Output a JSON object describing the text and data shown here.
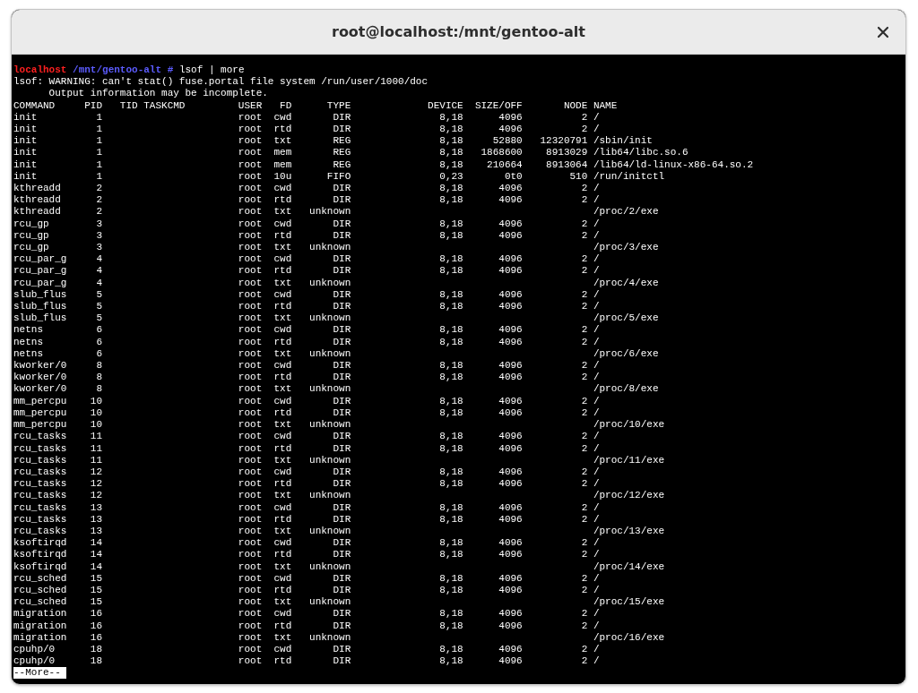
{
  "window": {
    "title": "root@localhost:/mnt/gentoo-alt"
  },
  "terminal": {
    "prompt": {
      "host": "localhost",
      "path": "/mnt/gentoo-alt",
      "symbol": "#",
      "command": "lsof | more"
    },
    "messages": [
      "lsof: WARNING: can't stat() fuse.portal file system /run/user/1000/doc",
      "      Output information may be incomplete."
    ],
    "columns": [
      "COMMAND",
      "PID",
      "TID",
      "TASKCMD",
      "USER",
      "FD",
      "TYPE",
      "DEVICE",
      "SIZE/OFF",
      "NODE",
      "NAME"
    ],
    "rows": [
      {
        "command": "init",
        "pid": "1",
        "user": "root",
        "fd": "cwd",
        "type": "DIR",
        "device": "8,18",
        "size_off": "4096",
        "node": "2",
        "name": "/"
      },
      {
        "command": "init",
        "pid": "1",
        "user": "root",
        "fd": "rtd",
        "type": "DIR",
        "device": "8,18",
        "size_off": "4096",
        "node": "2",
        "name": "/"
      },
      {
        "command": "init",
        "pid": "1",
        "user": "root",
        "fd": "txt",
        "type": "REG",
        "device": "8,18",
        "size_off": "52880",
        "node": "12320791",
        "name": "/sbin/init"
      },
      {
        "command": "init",
        "pid": "1",
        "user": "root",
        "fd": "mem",
        "type": "REG",
        "device": "8,18",
        "size_off": "1868600",
        "node": "8913029",
        "name": "/lib64/libc.so.6"
      },
      {
        "command": "init",
        "pid": "1",
        "user": "root",
        "fd": "mem",
        "type": "REG",
        "device": "8,18",
        "size_off": "210664",
        "node": "8913064",
        "name": "/lib64/ld-linux-x86-64.so.2"
      },
      {
        "command": "init",
        "pid": "1",
        "user": "root",
        "fd": "10u",
        "type": "FIFO",
        "device": "0,23",
        "size_off": "0t0",
        "node": "510",
        "name": "/run/initctl"
      },
      {
        "command": "kthreadd",
        "pid": "2",
        "user": "root",
        "fd": "cwd",
        "type": "DIR",
        "device": "8,18",
        "size_off": "4096",
        "node": "2",
        "name": "/"
      },
      {
        "command": "kthreadd",
        "pid": "2",
        "user": "root",
        "fd": "rtd",
        "type": "DIR",
        "device": "8,18",
        "size_off": "4096",
        "node": "2",
        "name": "/"
      },
      {
        "command": "kthreadd",
        "pid": "2",
        "user": "root",
        "fd": "txt",
        "type": "unknown",
        "name": "/proc/2/exe"
      },
      {
        "command": "rcu_gp",
        "pid": "3",
        "user": "root",
        "fd": "cwd",
        "type": "DIR",
        "device": "8,18",
        "size_off": "4096",
        "node": "2",
        "name": "/"
      },
      {
        "command": "rcu_gp",
        "pid": "3",
        "user": "root",
        "fd": "rtd",
        "type": "DIR",
        "device": "8,18",
        "size_off": "4096",
        "node": "2",
        "name": "/"
      },
      {
        "command": "rcu_gp",
        "pid": "3",
        "user": "root",
        "fd": "txt",
        "type": "unknown",
        "name": "/proc/3/exe"
      },
      {
        "command": "rcu_par_g",
        "pid": "4",
        "user": "root",
        "fd": "cwd",
        "type": "DIR",
        "device": "8,18",
        "size_off": "4096",
        "node": "2",
        "name": "/"
      },
      {
        "command": "rcu_par_g",
        "pid": "4",
        "user": "root",
        "fd": "rtd",
        "type": "DIR",
        "device": "8,18",
        "size_off": "4096",
        "node": "2",
        "name": "/"
      },
      {
        "command": "rcu_par_g",
        "pid": "4",
        "user": "root",
        "fd": "txt",
        "type": "unknown",
        "name": "/proc/4/exe"
      },
      {
        "command": "slub_flus",
        "pid": "5",
        "user": "root",
        "fd": "cwd",
        "type": "DIR",
        "device": "8,18",
        "size_off": "4096",
        "node": "2",
        "name": "/"
      },
      {
        "command": "slub_flus",
        "pid": "5",
        "user": "root",
        "fd": "rtd",
        "type": "DIR",
        "device": "8,18",
        "size_off": "4096",
        "node": "2",
        "name": "/"
      },
      {
        "command": "slub_flus",
        "pid": "5",
        "user": "root",
        "fd": "txt",
        "type": "unknown",
        "name": "/proc/5/exe"
      },
      {
        "command": "netns",
        "pid": "6",
        "user": "root",
        "fd": "cwd",
        "type": "DIR",
        "device": "8,18",
        "size_off": "4096",
        "node": "2",
        "name": "/"
      },
      {
        "command": "netns",
        "pid": "6",
        "user": "root",
        "fd": "rtd",
        "type": "DIR",
        "device": "8,18",
        "size_off": "4096",
        "node": "2",
        "name": "/"
      },
      {
        "command": "netns",
        "pid": "6",
        "user": "root",
        "fd": "txt",
        "type": "unknown",
        "name": "/proc/6/exe"
      },
      {
        "command": "kworker/0",
        "pid": "8",
        "user": "root",
        "fd": "cwd",
        "type": "DIR",
        "device": "8,18",
        "size_off": "4096",
        "node": "2",
        "name": "/"
      },
      {
        "command": "kworker/0",
        "pid": "8",
        "user": "root",
        "fd": "rtd",
        "type": "DIR",
        "device": "8,18",
        "size_off": "4096",
        "node": "2",
        "name": "/"
      },
      {
        "command": "kworker/0",
        "pid": "8",
        "user": "root",
        "fd": "txt",
        "type": "unknown",
        "name": "/proc/8/exe"
      },
      {
        "command": "mm_percpu",
        "pid": "10",
        "user": "root",
        "fd": "cwd",
        "type": "DIR",
        "device": "8,18",
        "size_off": "4096",
        "node": "2",
        "name": "/"
      },
      {
        "command": "mm_percpu",
        "pid": "10",
        "user": "root",
        "fd": "rtd",
        "type": "DIR",
        "device": "8,18",
        "size_off": "4096",
        "node": "2",
        "name": "/"
      },
      {
        "command": "mm_percpu",
        "pid": "10",
        "user": "root",
        "fd": "txt",
        "type": "unknown",
        "name": "/proc/10/exe"
      },
      {
        "command": "rcu_tasks",
        "pid": "11",
        "user": "root",
        "fd": "cwd",
        "type": "DIR",
        "device": "8,18",
        "size_off": "4096",
        "node": "2",
        "name": "/"
      },
      {
        "command": "rcu_tasks",
        "pid": "11",
        "user": "root",
        "fd": "rtd",
        "type": "DIR",
        "device": "8,18",
        "size_off": "4096",
        "node": "2",
        "name": "/"
      },
      {
        "command": "rcu_tasks",
        "pid": "11",
        "user": "root",
        "fd": "txt",
        "type": "unknown",
        "name": "/proc/11/exe"
      },
      {
        "command": "rcu_tasks",
        "pid": "12",
        "user": "root",
        "fd": "cwd",
        "type": "DIR",
        "device": "8,18",
        "size_off": "4096",
        "node": "2",
        "name": "/"
      },
      {
        "command": "rcu_tasks",
        "pid": "12",
        "user": "root",
        "fd": "rtd",
        "type": "DIR",
        "device": "8,18",
        "size_off": "4096",
        "node": "2",
        "name": "/"
      },
      {
        "command": "rcu_tasks",
        "pid": "12",
        "user": "root",
        "fd": "txt",
        "type": "unknown",
        "name": "/proc/12/exe"
      },
      {
        "command": "rcu_tasks",
        "pid": "13",
        "user": "root",
        "fd": "cwd",
        "type": "DIR",
        "device": "8,18",
        "size_off": "4096",
        "node": "2",
        "name": "/"
      },
      {
        "command": "rcu_tasks",
        "pid": "13",
        "user": "root",
        "fd": "rtd",
        "type": "DIR",
        "device": "8,18",
        "size_off": "4096",
        "node": "2",
        "name": "/"
      },
      {
        "command": "rcu_tasks",
        "pid": "13",
        "user": "root",
        "fd": "txt",
        "type": "unknown",
        "name": "/proc/13/exe"
      },
      {
        "command": "ksoftirqd",
        "pid": "14",
        "user": "root",
        "fd": "cwd",
        "type": "DIR",
        "device": "8,18",
        "size_off": "4096",
        "node": "2",
        "name": "/"
      },
      {
        "command": "ksoftirqd",
        "pid": "14",
        "user": "root",
        "fd": "rtd",
        "type": "DIR",
        "device": "8,18",
        "size_off": "4096",
        "node": "2",
        "name": "/"
      },
      {
        "command": "ksoftirqd",
        "pid": "14",
        "user": "root",
        "fd": "txt",
        "type": "unknown",
        "name": "/proc/14/exe"
      },
      {
        "command": "rcu_sched",
        "pid": "15",
        "user": "root",
        "fd": "cwd",
        "type": "DIR",
        "device": "8,18",
        "size_off": "4096",
        "node": "2",
        "name": "/"
      },
      {
        "command": "rcu_sched",
        "pid": "15",
        "user": "root",
        "fd": "rtd",
        "type": "DIR",
        "device": "8,18",
        "size_off": "4096",
        "node": "2",
        "name": "/"
      },
      {
        "command": "rcu_sched",
        "pid": "15",
        "user": "root",
        "fd": "txt",
        "type": "unknown",
        "name": "/proc/15/exe"
      },
      {
        "command": "migration",
        "pid": "16",
        "user": "root",
        "fd": "cwd",
        "type": "DIR",
        "device": "8,18",
        "size_off": "4096",
        "node": "2",
        "name": "/"
      },
      {
        "command": "migration",
        "pid": "16",
        "user": "root",
        "fd": "rtd",
        "type": "DIR",
        "device": "8,18",
        "size_off": "4096",
        "node": "2",
        "name": "/"
      },
      {
        "command": "migration",
        "pid": "16",
        "user": "root",
        "fd": "txt",
        "type": "unknown",
        "name": "/proc/16/exe"
      },
      {
        "command": "cpuhp/0",
        "pid": "18",
        "user": "root",
        "fd": "cwd",
        "type": "DIR",
        "device": "8,18",
        "size_off": "4096",
        "node": "2",
        "name": "/"
      },
      {
        "command": "cpuhp/0",
        "pid": "18",
        "user": "root",
        "fd": "rtd",
        "type": "DIR",
        "device": "8,18",
        "size_off": "4096",
        "node": "2",
        "name": "/"
      }
    ],
    "pager": "--More--"
  }
}
